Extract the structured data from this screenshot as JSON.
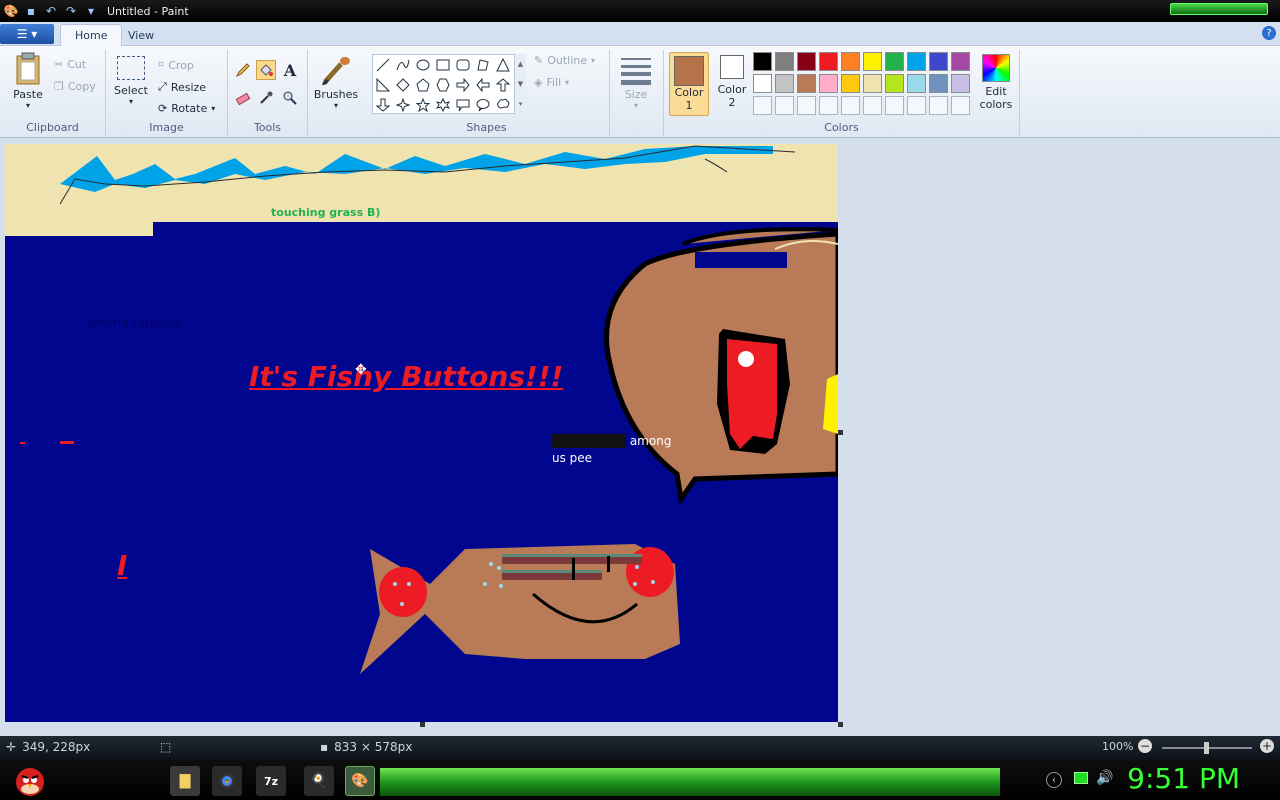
{
  "window": {
    "title": "Untitled - Paint"
  },
  "tabs": [
    {
      "label": "Home"
    },
    {
      "label": "View"
    }
  ],
  "ribbon": {
    "clipboard": {
      "label": "Clipboard",
      "paste": "Paste",
      "cut": "Cut",
      "copy": "Copy"
    },
    "image": {
      "label": "Image",
      "select": "Select",
      "crop": "Crop",
      "resize": "Resize",
      "rotate": "Rotate"
    },
    "tools": {
      "label": "Tools",
      "text_glyph": "A"
    },
    "brushes": {
      "label": "Brushes"
    },
    "shapes": {
      "label": "Shapes",
      "outline": "Outline",
      "fill": "Fill"
    },
    "size": {
      "label": "Size"
    },
    "colors": {
      "label": "Colors",
      "color1": {
        "line1": "Color",
        "line2": "1",
        "value": "#b5734a"
      },
      "color2": {
        "line1": "Color",
        "line2": "2",
        "value": "#ffffff"
      },
      "edit": {
        "line1": "Edit",
        "line2": "colors"
      },
      "palette_row1": [
        "#000000",
        "#7f7f7f",
        "#880015",
        "#ed1c24",
        "#ff7f27",
        "#fff200",
        "#22b14c",
        "#00a2e8",
        "#3f48cc",
        "#a349a4"
      ],
      "palette_row2": [
        "#ffffff",
        "#c3c3c3",
        "#b97a57",
        "#ffaec9",
        "#ffc90e",
        "#efe4b0",
        "#b5e61d",
        "#99d9ea",
        "#7092be",
        "#c8bfe7"
      ]
    }
  },
  "canvas_texts": {
    "grass": "touching grass B)",
    "dark_note": "among rapistsd",
    "headline": "It's Fishy Buttons!!!",
    "among_line1": "among",
    "among_line2": "us pee",
    "letter_i": "I"
  },
  "status": {
    "cursor": "349, 228px",
    "size": "833 × 578px",
    "zoom": "100%"
  },
  "taskbar": {
    "time": "9:51 PM",
    "zip_label": "7z"
  }
}
